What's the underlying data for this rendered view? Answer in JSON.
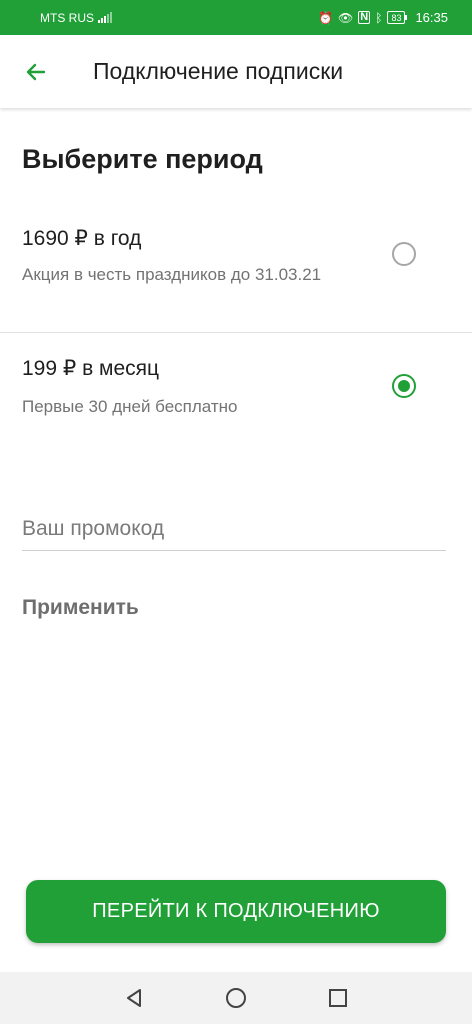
{
  "status_bar": {
    "carrier": "MTS RUS",
    "network_indicator": "4G",
    "icons": [
      "alarm-icon",
      "eye-comfort-icon",
      "nfc-icon",
      "bluetooth-icon"
    ],
    "battery": "83",
    "time": "16:35",
    "background_color": "#21a038"
  },
  "app_bar": {
    "back_icon": "arrow-left-icon",
    "title": "Подключение подписки"
  },
  "period": {
    "title": "Выберите период",
    "options": [
      {
        "price": "1690 ₽ в год",
        "description": "Акция в честь праздников до 31.03.21",
        "selected": false
      },
      {
        "price": "199 ₽ в месяц",
        "description": "Первые 30 дней бесплатно",
        "selected": true
      }
    ]
  },
  "promo": {
    "placeholder": "Ваш промокод",
    "value": "",
    "apply_label": "Применить"
  },
  "primary_button": {
    "label": "ПЕРЕЙТИ К ПОДКЛЮЧЕНИЮ"
  },
  "nav_bar": {
    "buttons": [
      "back-triangle-icon",
      "home-circle-icon",
      "recents-square-icon"
    ]
  },
  "colors": {
    "accent": "#21a038",
    "text_primary": "#1f1f1f",
    "text_secondary": "#737373"
  }
}
